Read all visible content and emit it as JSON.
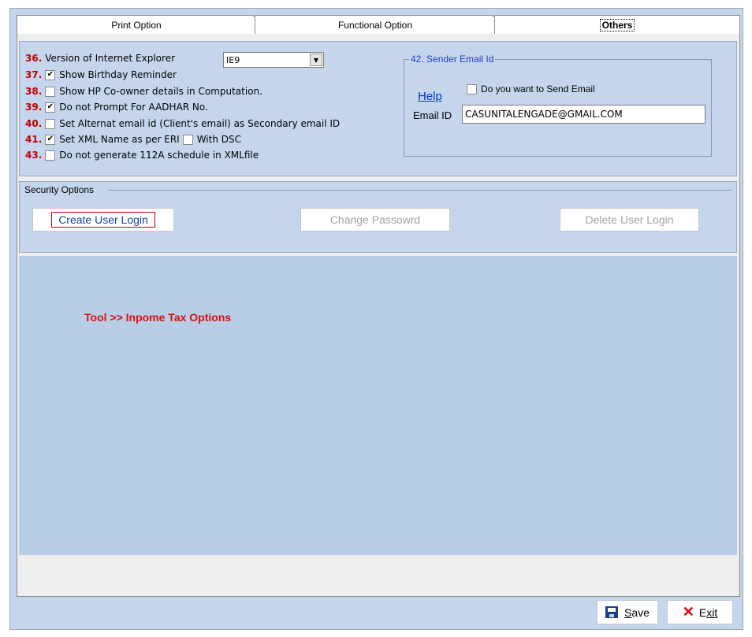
{
  "tabs": {
    "print_option": "Print Option",
    "functional_option": "Functional Option",
    "others": "Others"
  },
  "options": [
    {
      "num": "36.",
      "label": "Version of Internet Explorer",
      "has_checkbox": false
    },
    {
      "num": "37.",
      "label": "Show Birthday Reminder",
      "checked": true
    },
    {
      "num": "38.",
      "label": "Show HP Co-owner details  in Computation.",
      "checked": false
    },
    {
      "num": "39.",
      "label": "Do not Prompt  For AADHAR No.",
      "checked": true
    },
    {
      "num": "40.",
      "label": "Set Alternat email id (Client's email) as Secondary email ID",
      "checked": false
    },
    {
      "num": "41.",
      "label": "Set XML Name as per ERI",
      "checked": true,
      "extra_label": "With DSC",
      "extra_checked": false
    },
    {
      "num": "43.",
      "label": "Do not generate 112A schedule in XMLfile",
      "checked": false
    }
  ],
  "ie_version": {
    "selected": "IE9"
  },
  "sender_email": {
    "legend": "42. Sender Email Id",
    "help_label": "Help",
    "send_email_label": "Do you want to Send Email",
    "send_email_checked": false,
    "email_id_label": "Email ID",
    "email_value": "CASUNITALENGADE@GMAIL.COM"
  },
  "security": {
    "title": "Security Options",
    "create_label": "Create User Login",
    "change_label": "Change Passowrd",
    "delete_label": "Delete User Login"
  },
  "content": {
    "path_label": "Tool >> Inpome Tax Options"
  },
  "footer": {
    "save_label": "ave",
    "save_key": "S",
    "exit_label": "E",
    "exit_rest": "xit"
  },
  "colors": {
    "accent_red": "#c00000",
    "panel_blue": "#c5d6ec",
    "link_blue": "#0033cc"
  }
}
